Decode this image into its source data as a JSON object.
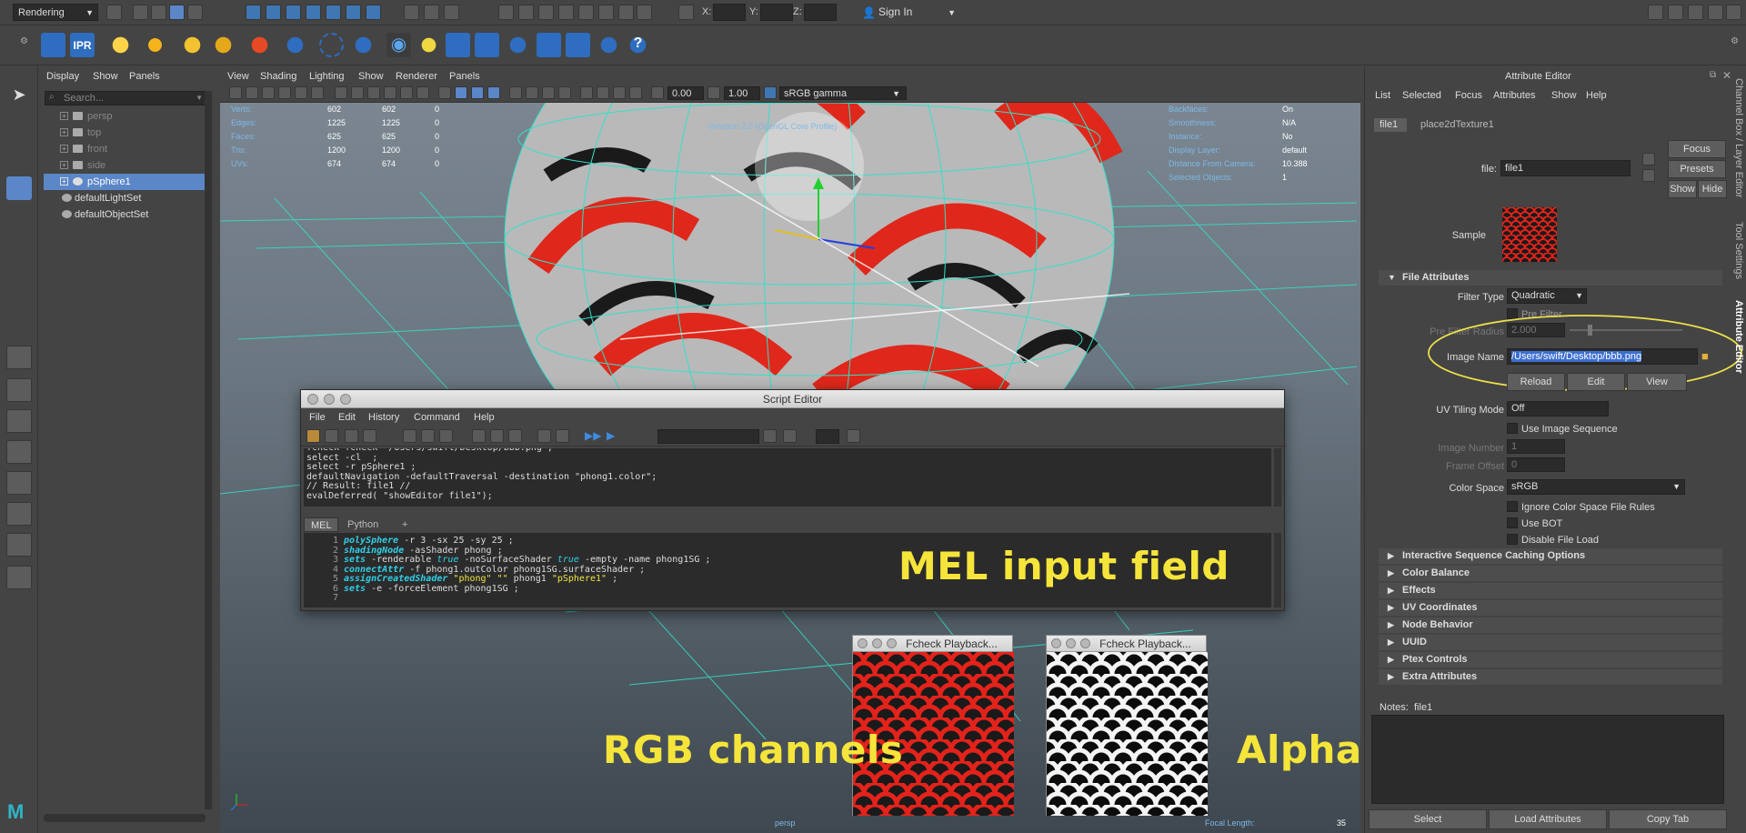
{
  "toolbar": {
    "mode": "Rendering",
    "coord_x": "X:",
    "coord_y": "Y:",
    "coord_z": "Z:",
    "sign_in": "Sign In"
  },
  "shelf": {
    "ipr_label": "IPR"
  },
  "outliner": {
    "menu": [
      "Display",
      "Show",
      "Panels"
    ],
    "search_placeholder": "Search...",
    "items": [
      {
        "label": "persp"
      },
      {
        "label": "top"
      },
      {
        "label": "front"
      },
      {
        "label": "side"
      },
      {
        "label": "pSphere1"
      },
      {
        "label": "defaultLightSet"
      },
      {
        "label": "defaultObjectSet"
      }
    ]
  },
  "viewport": {
    "menu": [
      "View",
      "Shading",
      "Lighting",
      "Show",
      "Renderer",
      "Panels"
    ],
    "exposure": "0.00",
    "gamma": "1.00",
    "colorspace": "sRGB gamma",
    "hud_left": [
      {
        "label": "Verts:",
        "a": "602",
        "b": "602",
        "c": "0"
      },
      {
        "label": "Edges:",
        "a": "1225",
        "b": "1225",
        "c": "0"
      },
      {
        "label": "Faces:",
        "a": "625",
        "b": "625",
        "c": "0"
      },
      {
        "label": "Tris:",
        "a": "1200",
        "b": "1200",
        "c": "0"
      },
      {
        "label": "UVs:",
        "a": "674",
        "b": "674",
        "c": "0"
      }
    ],
    "hud_right": [
      {
        "label": "Backfaces:",
        "value": "On"
      },
      {
        "label": "Smoothness:",
        "value": "N/A"
      },
      {
        "label": "Instance:",
        "value": "No"
      },
      {
        "label": "Display Layer:",
        "value": "default"
      },
      {
        "label": "Distance From Camera:",
        "value": "10.388"
      },
      {
        "label": "Selected Objects:",
        "value": "1"
      }
    ],
    "viewport_label": "Viewport 2.0 (OpenGL Core Profile)",
    "camera": "persp",
    "focal_label": "Focal Length:",
    "focal_value": "35"
  },
  "script_editor": {
    "title": "Script Editor",
    "menu": [
      "File",
      "Edit",
      "History",
      "Command",
      "Help"
    ],
    "history": [
      "fcheck fcheck \"/Users/swift/Desktop/bbb.png\";",
      "select -cl  ;",
      "select -r pSphere1 ;",
      "defaultNavigation -defaultTraversal -destination \"phong1.color\";",
      "// Result: file1 //",
      "evalDeferred( \"showEditor file1\");"
    ],
    "tabs": [
      "MEL",
      "Python",
      "+"
    ],
    "line_numbers": [
      "1",
      "2",
      "3",
      "4",
      "5",
      "6",
      "7"
    ]
  },
  "annotations": {
    "mel": "MEL input field",
    "rgb": "RGB channels",
    "alpha": "Alpha channel"
  },
  "fcheck": {
    "title1": "Fcheck Playback...",
    "title2": "Fcheck Playback..."
  },
  "attribute_editor": {
    "title": "Attribute Editor",
    "menu": [
      "List",
      "Selected",
      "Focus",
      "Attributes",
      "Show",
      "Help"
    ],
    "tabs": [
      "file1",
      "place2dTexture1"
    ],
    "file_label": "file:",
    "file_value": "file1",
    "focus": "Focus",
    "presets": "Presets",
    "show": "Show",
    "hide": "Hide",
    "sample": "Sample",
    "file_attributes": "File Attributes",
    "filter_type_label": "Filter Type",
    "filter_type": "Quadratic",
    "pre_filter": "Pre Filter",
    "pre_filter_radius_label": "Pre Filter Radius",
    "pre_filter_radius": "2.000",
    "image_name_label": "Image Name",
    "image_name": "/Users/swift/Desktop/bbb.png",
    "reload": "Reload",
    "edit": "Edit",
    "view": "View",
    "uv_tiling_label": "UV Tiling Mode",
    "uv_tiling": "Off",
    "use_image_sequence": "Use Image Sequence",
    "image_number_label": "Image Number",
    "image_number": "1",
    "frame_offset_label": "Frame Offset",
    "frame_offset": "0",
    "color_space_label": "Color Space",
    "color_space": "sRGB",
    "ignore_cs": "Ignore Color Space File Rules",
    "use_bot": "Use BOT",
    "disable_file_load": "Disable File Load",
    "sections": [
      "Interactive Sequence Caching Options",
      "Color Balance",
      "Effects",
      "UV Coordinates",
      "Node Behavior",
      "UUID",
      "Ptex Controls",
      "Extra Attributes"
    ],
    "notes_label": "Notes:",
    "notes_value": "file1",
    "select": "Select",
    "load_attributes": "Load Attributes",
    "copy_tab": "Copy Tab",
    "side_tabs": [
      "Channel Box / Layer Editor",
      "Tool Settings",
      "Attribute Editor"
    ]
  }
}
